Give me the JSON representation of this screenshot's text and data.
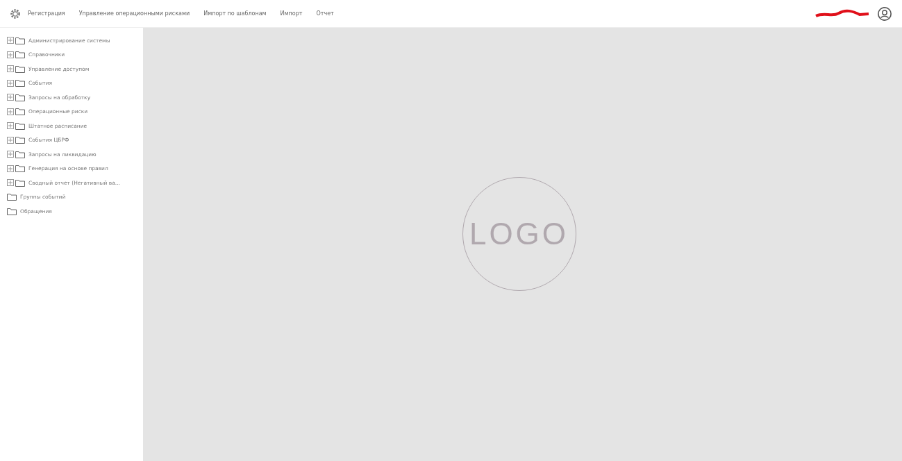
{
  "menu": [
    {
      "label": "Регистрация"
    },
    {
      "label": "Управление операционными рисками"
    },
    {
      "label": "Импорт по шаблонам"
    },
    {
      "label": "Импорт"
    },
    {
      "label": "Отчет"
    }
  ],
  "tree": [
    {
      "label": "Администрирование системы",
      "expandable": true
    },
    {
      "label": "Справочники",
      "expandable": true
    },
    {
      "label": "Управление доступом",
      "expandable": true
    },
    {
      "label": "События",
      "expandable": true
    },
    {
      "label": "Запросы на обработку",
      "expandable": true
    },
    {
      "label": "Операционные риски",
      "expandable": true
    },
    {
      "label": "Штатное расписание",
      "expandable": true
    },
    {
      "label": "События ЦБРФ",
      "expandable": true
    },
    {
      "label": "Запросы на ликвидацию",
      "expandable": true
    },
    {
      "label": "Генерация на основе правил",
      "expandable": true
    },
    {
      "label": "Сводный отчет (Негативный ва...",
      "expandable": true
    },
    {
      "label": "Группы событий",
      "expandable": false
    },
    {
      "label": "Обращения",
      "expandable": false
    }
  ],
  "logo": {
    "text": "LOGO"
  }
}
